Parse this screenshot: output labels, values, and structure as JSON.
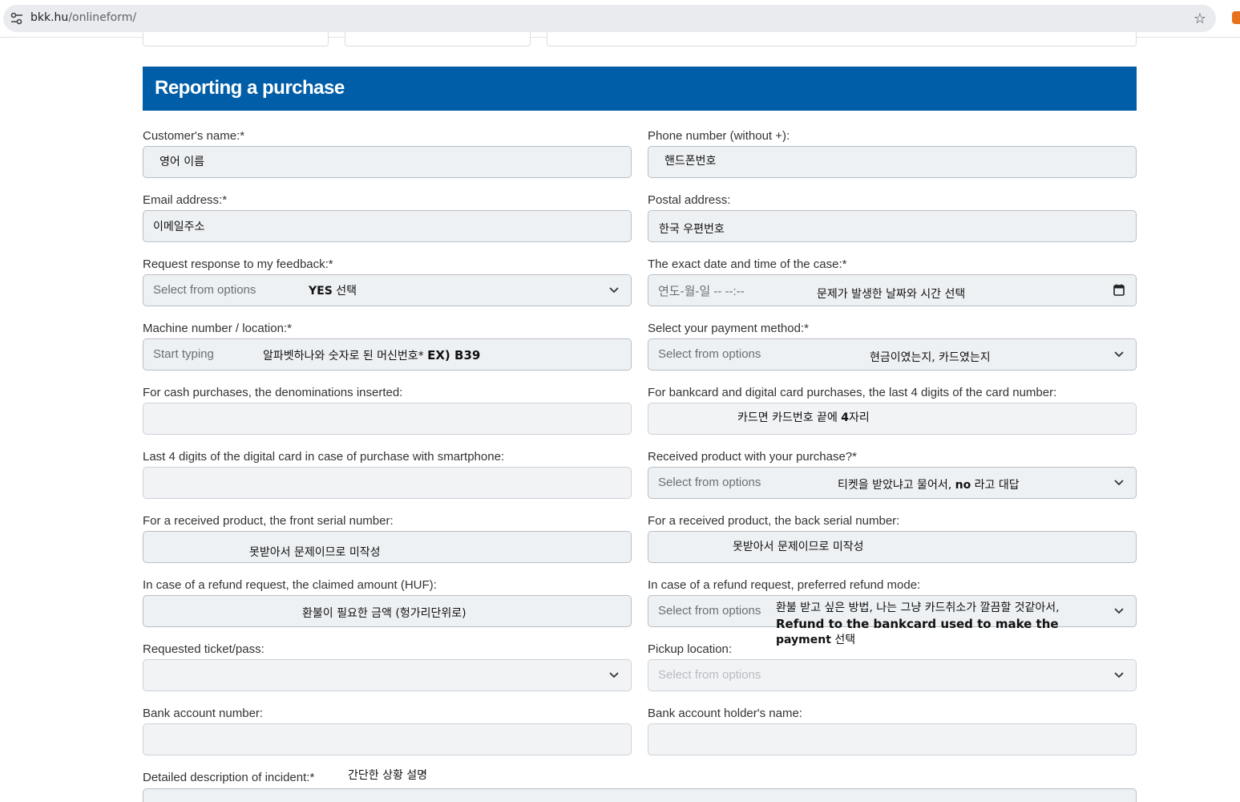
{
  "browser": {
    "url_host": "bkk.hu",
    "url_path": "/onlineform/"
  },
  "banner": {
    "title": "Reporting a purchase"
  },
  "fields": {
    "customer_name": {
      "label": "Customer's name:*",
      "value": "영어 이름"
    },
    "phone": {
      "label": "Phone number (without +):",
      "value": "핸드폰번호"
    },
    "email": {
      "label": "Email address:*",
      "value": "이메일주소"
    },
    "postal": {
      "label": "Postal address:",
      "value": "한국 우편번호"
    },
    "response": {
      "label": "Request response to my feedback:*",
      "placeholder": "Select from options",
      "note_bold": "YES",
      "note": " 선택"
    },
    "datetime": {
      "label": "The exact date and time of the case:*",
      "placeholder": "연도-월-일 -- --:--",
      "note": "문제가 발생한 날짜와 시간 선택"
    },
    "machine": {
      "label": "Machine number / location:*",
      "placeholder": "Start typing",
      "note": "알파벳하나와 숫자로 된 머신번호* ",
      "note_bold": "EX) B39"
    },
    "payment": {
      "label": "Select your payment method:*",
      "placeholder": "Select from options",
      "note": "현금이였는지, 카드였는지"
    },
    "cash_denoms": {
      "label": "For cash purchases, the denominations inserted:"
    },
    "card_last4": {
      "label": "For bankcard and digital card purchases, the last 4 digits of the card number:",
      "note": "카드면 카드번호 끝에 ",
      "note_bold": "4",
      "note2": "자리"
    },
    "digital_last4": {
      "label": "Last 4 digits of the digital card in case of purchase with smartphone:"
    },
    "received": {
      "label": "Received product with your purchase?*",
      "placeholder": "Select from options",
      "note": "티켓을 받았냐고 물어서, ",
      "note_bold": "no",
      "note2": " 라고 대답"
    },
    "front_serial": {
      "label": "For a received product, the front serial number:",
      "note": "못받아서 문제이므로 미작성"
    },
    "back_serial": {
      "label": "For a received product, the back serial number:",
      "note": "못받아서 문제이므로 미작성"
    },
    "claimed_amount": {
      "label": "In case of a refund request, the claimed amount (HUF):",
      "note": "환불이 필요한 금액 (헝가리단위로)"
    },
    "refund_mode": {
      "label": "In case of a refund request, preferred refund mode:",
      "placeholder": "Select from options",
      "note_line1": "환불 받고 싶은 방법, 나는 그냥 카드취소가 깔끔할 것같아서,",
      "note_line2": "Refund to the bankcard used to make the",
      "note_line3_bold": "payment",
      "note_line3": " 선택"
    },
    "ticket_pass": {
      "label": "Requested ticket/pass:"
    },
    "pickup": {
      "label": "Pickup location:",
      "placeholder": "Select from options"
    },
    "bank_account": {
      "label": "Bank account number:"
    },
    "holder_name": {
      "label": "Bank account holder's name:"
    },
    "description": {
      "label": "Detailed description of incident:*",
      "note": "간단한 상황 설명"
    }
  },
  "icons": {
    "dropdown": "chevron-down-icon",
    "calendar": "calendar-icon",
    "bookmark": "star-icon",
    "site_info": "tune-icon"
  },
  "colors": {
    "banner": "#005ea8",
    "field_bg": "#eef1f3"
  }
}
